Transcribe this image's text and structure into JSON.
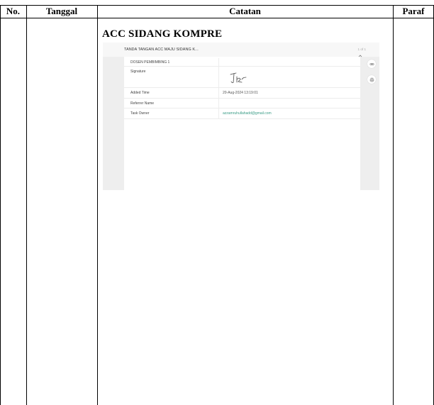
{
  "table": {
    "headers": {
      "no": "No.",
      "tanggal": "Tanggal",
      "catatan": "Catatan",
      "paraf": "Paraf"
    }
  },
  "note": {
    "title": "ACC SIDANG KOMPRE",
    "document": {
      "title": "TANDA TANGAN ACC MAJU SIDANG K...",
      "page_indicator": "1 of 1",
      "rows": [
        {
          "label": "DOSEN PEMBIMBING 1",
          "value": ""
        },
        {
          "label": "Signature",
          "value": ""
        },
        {
          "label": "Added Time",
          "value": "20-Aug-2024 13:19:01"
        },
        {
          "label": "Referrer Name",
          "value": ""
        },
        {
          "label": "Task Owner",
          "value": "azzamruhullahadd@gmail.com"
        }
      ],
      "icons": [
        "chevron-up-icon",
        "link-icon",
        "print-icon"
      ]
    }
  }
}
